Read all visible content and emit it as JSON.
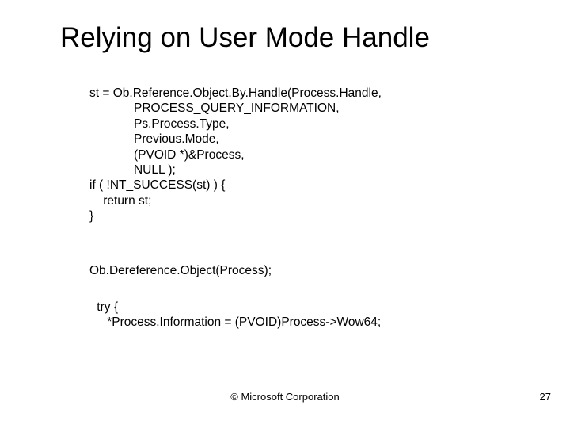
{
  "slide": {
    "title": "Relying on User Mode Handle",
    "code": {
      "l1": "st = Ob.Reference.Object.By.Handle(Process.Handle,",
      "l2": "             PROCESS_QUERY_INFORMATION,",
      "l3": "             Ps.Process.Type,",
      "l4": "             Previous.Mode,",
      "l5": "             (PVOID *)&Process,",
      "l6": "             NULL );",
      "l7": "if ( !NT_SUCCESS(st) ) {",
      "l8": "    return st;",
      "l9": "}"
    },
    "deref": "Ob.Dereference.Object(Process);",
    "try": {
      "l1": " try {",
      "l2": "    *Process.Information = (PVOID)Process->Wow64;"
    },
    "footer": "© Microsoft Corporation",
    "page": "27"
  }
}
